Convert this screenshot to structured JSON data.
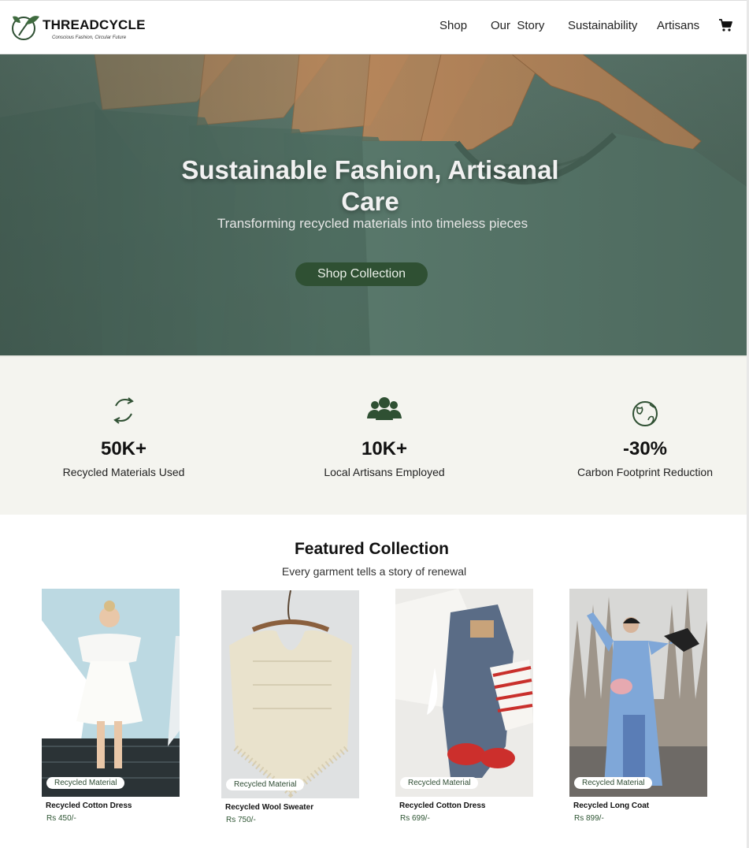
{
  "brand": {
    "name": "THREADCYCLE",
    "tagline": "Conscious Fashion, Circular Future"
  },
  "nav": {
    "items": [
      {
        "label": "Shop"
      },
      {
        "label": "Our  Story"
      },
      {
        "label": "Sustainability"
      },
      {
        "label": "Artisans"
      }
    ],
    "cart_icon": "cart-icon"
  },
  "hero": {
    "title": "Sustainable Fashion, Artisanal Care",
    "subtitle": "Transforming recycled materials into timeless pieces",
    "cta": "Shop Collection"
  },
  "stats": [
    {
      "icon": "recycle-icon",
      "value": "50K+",
      "label": "Recycled Materials Used"
    },
    {
      "icon": "people-icon",
      "value": "10K+",
      "label": "Local Artisans Employed"
    },
    {
      "icon": "globe-icon",
      "value": "-30%",
      "label": "Carbon Footprint Reduction"
    }
  ],
  "featured": {
    "title": "Featured Collection",
    "subtitle": "Every garment tells a story of renewal",
    "products": [
      {
        "badge": "Recycled Material",
        "name": "Recycled Cotton Dress",
        "price": "Rs 450/-"
      },
      {
        "badge": "Recycled Material",
        "name": "Recycled Wool Sweater",
        "price": "Rs 750/-"
      },
      {
        "badge": "Recycled Material",
        "name": "Recycled Cotton Dress",
        "price": "Rs 699/-"
      },
      {
        "badge": "Recycled Material",
        "name": "Recycled Long Coat",
        "price": "Rs 899/-"
      }
    ]
  },
  "colors": {
    "accent": "#2f5033",
    "stats_bg": "#f4f4ef",
    "hero": "#5e7a6f"
  }
}
